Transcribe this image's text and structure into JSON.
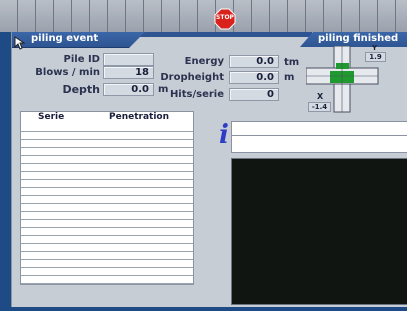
{
  "toolbar": {
    "stop_label": "STOP"
  },
  "tabs": {
    "left": "piling event",
    "right": "piling finished"
  },
  "fields": {
    "pile_id": {
      "label": "Pile ID",
      "value": ""
    },
    "blows_per_min": {
      "label": "Blows / min",
      "value": "18"
    },
    "depth": {
      "label": "Depth",
      "value": "0.0",
      "unit": "m"
    },
    "energy": {
      "label": "Energy",
      "value": "0.0",
      "unit": "tm"
    },
    "dropheight": {
      "label": "Dropheight",
      "value": "0.0",
      "unit": "m"
    },
    "hits_serie": {
      "label": "Hits/serie",
      "value": "0"
    }
  },
  "inclinometer": {
    "y_label": "Y",
    "y_value": "1.9",
    "x_label": "X",
    "x_value": "-1.4",
    "indicator_color": "#1f9a2e"
  },
  "table": {
    "columns": [
      "Serie",
      "Penetration"
    ]
  },
  "info": {
    "icon": "info-icon",
    "line1": "",
    "line2": ""
  },
  "colors": {
    "tab": "#2e5592",
    "panel": "#c7cdd4",
    "desktop": "#1e4a86"
  }
}
